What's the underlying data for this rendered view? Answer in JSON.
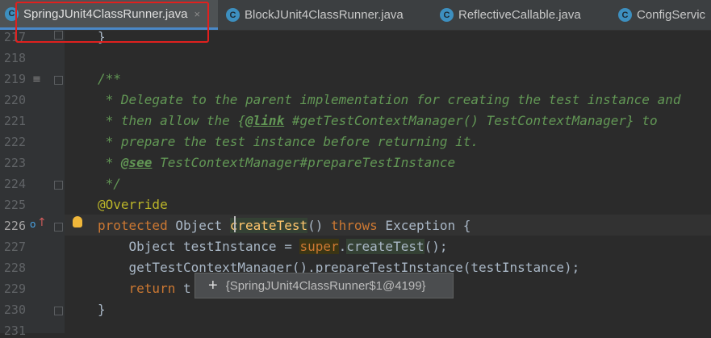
{
  "tabs": [
    {
      "label": "SpringJUnit4ClassRunner.java",
      "icon": "C",
      "active": true
    },
    {
      "label": "BlockJUnit4ClassRunner.java",
      "icon": "C",
      "active": false
    },
    {
      "label": "ReflectiveCallable.java",
      "icon": "C",
      "active": false
    },
    {
      "label": "ConfigServic",
      "icon": "C",
      "active": false
    }
  ],
  "tab_close": "×",
  "line_numbers": [
    "217",
    "218",
    "219",
    "220",
    "221",
    "222",
    "223",
    "224",
    "225",
    "226",
    "227",
    "228",
    "229",
    "230",
    "231"
  ],
  "code": {
    "l217": "}",
    "l219": "/**",
    "l220_a": " * Delegate to the parent implementation for creating the test instance and",
    "l221_a": " * then allow the {",
    "l221_tag": "@link",
    "l221_b": " #getTestContextManager() TestContextManager} to",
    "l222": " * prepare the test instance before returning it.",
    "l223_a": " * ",
    "l223_tag": "@see",
    "l223_b": " TestContextManager#prepareTestInstance",
    "l224": " */",
    "l225": "@Override",
    "l226_kw": "protected",
    "l226_a": " Object ",
    "l226_fn": "createTest",
    "l226_b": "() ",
    "l226_kw2": "throws",
    "l226_c": " Exception {",
    "l227_a": "    Object testInstance = ",
    "l227_kw": "super",
    "l227_b": ".",
    "l227_fn": "createTest",
    "l227_c": "();",
    "l228": "    getTestContextManager().prepareTestInstance(testInstance);",
    "l229_kw": "    return",
    "l229_a": " t",
    "l230": "}"
  },
  "tooltip": {
    "plus": "+",
    "text": "{SpringJUnit4ClassRunner$1@4199}"
  },
  "gutter_icons": {
    "override": "o",
    "arrow": "↑",
    "doc": "≡"
  },
  "colors": {
    "tab_active_underline": "#4a88c7",
    "highlight_box": "#e0201e",
    "comment": "#629755",
    "keyword": "#cc7832",
    "annotation": "#bbb529",
    "method": "#ffc66d"
  }
}
